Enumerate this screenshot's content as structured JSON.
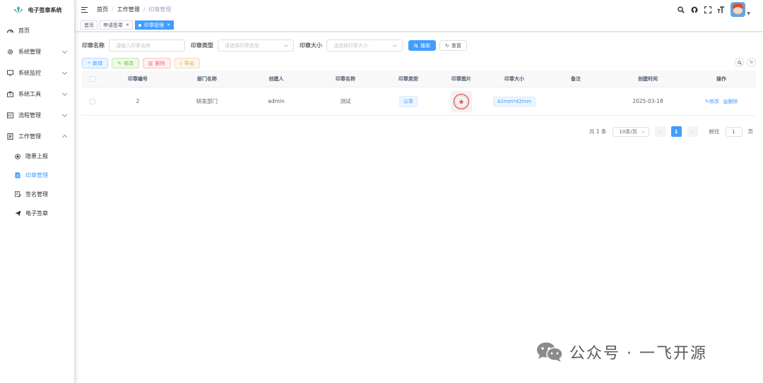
{
  "app": {
    "title": "电子签章系统"
  },
  "sidebar": {
    "items": [
      {
        "label": "首页",
        "icon": "dashboard-icon"
      },
      {
        "label": "系统管理",
        "icon": "gear-icon"
      },
      {
        "label": "系统监控",
        "icon": "monitor-icon"
      },
      {
        "label": "系统工具",
        "icon": "toolbox-icon"
      },
      {
        "label": "流程管理",
        "icon": "flow-icon"
      },
      {
        "label": "工作管理",
        "icon": "work-icon"
      }
    ],
    "sub_items": [
      {
        "label": "隐患上报",
        "icon": "target-icon"
      },
      {
        "label": "印章管理",
        "icon": "document-icon"
      },
      {
        "label": "签名管理",
        "icon": "signature-icon"
      },
      {
        "label": "电子签章",
        "icon": "send-icon"
      }
    ]
  },
  "header": {
    "breadcrumb": [
      "首页",
      "工作管理",
      "印章管理"
    ]
  },
  "tags": [
    {
      "label": "首页"
    },
    {
      "label": "申请签章"
    },
    {
      "label": "印章管理"
    }
  ],
  "search": {
    "seal_name_label": "印章名称",
    "seal_name_placeholder": "请输入印章名称",
    "seal_type_label": "印章类型",
    "seal_type_placeholder": "请选择印章类型",
    "seal_size_label": "印章大小",
    "seal_size_placeholder": "请选择印章大小",
    "search_button": "搜索",
    "reset_button": "重置"
  },
  "toolbar": {
    "add": "新增",
    "edit": "修改",
    "delete": "删除",
    "export": "导出"
  },
  "table": {
    "columns": [
      "印章编号",
      "部门名称",
      "创建人",
      "印章名称",
      "印章类型",
      "印章图片",
      "印章大小",
      "备注",
      "创建时间",
      "操作"
    ],
    "rows": [
      {
        "id": "2",
        "dept": "研发部门",
        "creator": "admin",
        "name": "测试",
        "type": "公章",
        "size": "42mm*42mm",
        "remark": "",
        "created": "2025-03-18",
        "op_edit": "修改",
        "op_delete": "删除"
      }
    ]
  },
  "pagination": {
    "total_text": "共 1 条",
    "page_size": "10条/页",
    "current_page": "1",
    "goto_prefix": "前往",
    "goto_value": "1",
    "goto_suffix": "页"
  },
  "watermark": {
    "text": "公众号 · 一飞开源"
  },
  "colors": {
    "primary": "#409eff",
    "seal_red": "#e54a4a"
  }
}
